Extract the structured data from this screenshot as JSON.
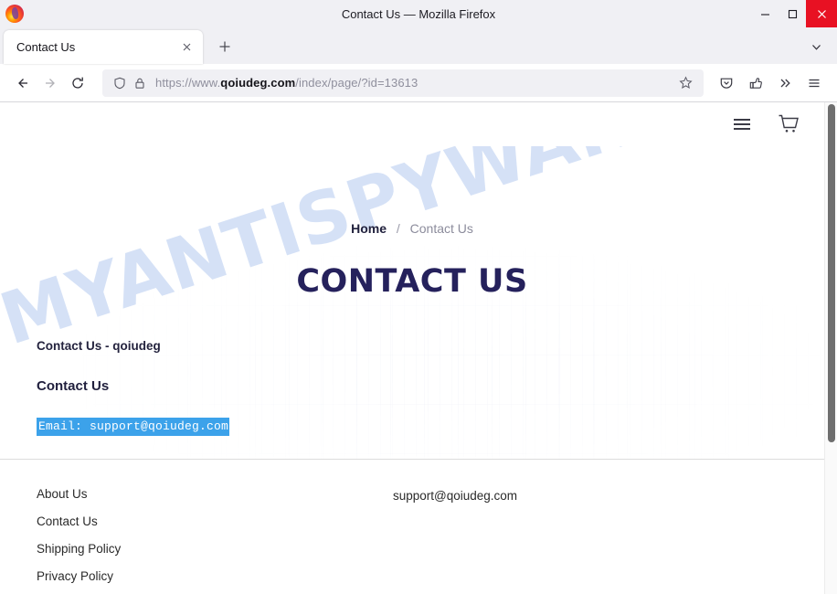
{
  "window": {
    "title": "Contact Us — Mozilla Firefox",
    "controls": {
      "minimize": "minimize-button",
      "maximize": "maximize-button",
      "close": "close-button"
    }
  },
  "tabs": {
    "items": [
      {
        "label": "Contact Us",
        "active": true
      }
    ],
    "new_tab_label": "+",
    "list_all_label": "v"
  },
  "navbar": {
    "back": "Back",
    "forward": "Forward",
    "reload": "Reload",
    "url_full": "https://www.qoiudeg.com/index/page/?id=13613",
    "url_prefix": "https://www.",
    "url_host": "qoiudeg.com",
    "url_path": "/index/page/?id=13613",
    "bookmark": "Bookmark this page",
    "pocket": "Save to Pocket",
    "extensions": "Extensions",
    "overflow": "More tools",
    "appmenu": "Open application menu"
  },
  "site": {
    "header": {
      "menu": "menu-icon",
      "cart": "cart-icon"
    },
    "breadcrumb": {
      "home": "Home",
      "separator": "/",
      "current": "Contact Us"
    },
    "page_title": "CONTACT US",
    "content": {
      "subtitle": "Contact Us - qoiudeg",
      "heading": "Contact Us",
      "email_line": "Email: support@qoiudeg.com"
    },
    "watermark": "MYANTISPYWARE.COM",
    "footer": {
      "links": [
        "About Us",
        "Contact Us",
        "Shipping Policy",
        "Privacy Policy"
      ],
      "email": "support@qoiudeg.com"
    }
  },
  "colors": {
    "title_accent": "#25215c",
    "close_button": "#e81123",
    "selection": "#3ca2ea",
    "watermark": "#bcd0f2"
  }
}
